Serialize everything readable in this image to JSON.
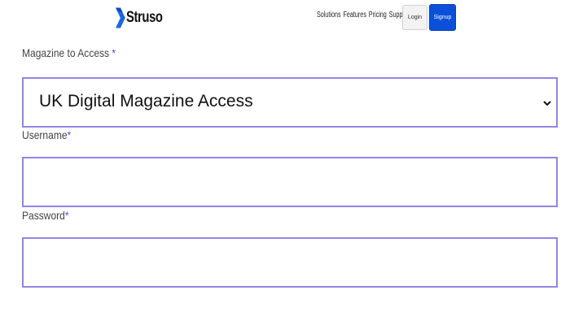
{
  "header": {
    "brand": "Struso",
    "nav": [
      "Solutions",
      "Features",
      "Pricing",
      "Support"
    ],
    "login_label": "Login",
    "signup_label": "Signup"
  },
  "form": {
    "magazine_label": "Magazine to Access",
    "magazine_selected": "UK Digital Magazine Access",
    "username_label": "Username",
    "username_value": "",
    "password_label": "Password",
    "password_value": "",
    "required_marker": "*"
  },
  "colors": {
    "accent": "#0a50d8",
    "field_border": "#8f86e8",
    "required": "#3b56e6"
  }
}
